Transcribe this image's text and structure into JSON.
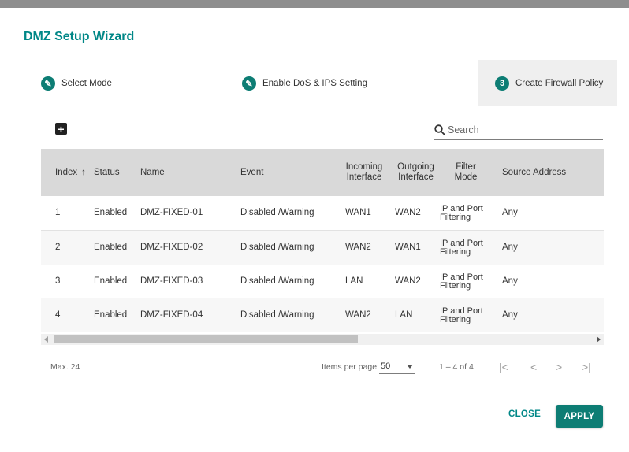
{
  "dialog": {
    "title": "DMZ Setup Wizard"
  },
  "stepper": {
    "steps": [
      {
        "label": "Select Mode",
        "marker": "✎",
        "icon": "pencil-icon"
      },
      {
        "label": "Enable DoS & IPS Setting",
        "marker": "✎",
        "icon": "pencil-icon"
      },
      {
        "label": "Create Firewall Policy",
        "marker": "3"
      }
    ],
    "active_color": "#0d7d74"
  },
  "toolbar": {
    "add_icon": "plus-square-icon",
    "add_glyph": "+",
    "search_placeholder": "Search",
    "search_value": ""
  },
  "table": {
    "sort_arrow": "↑",
    "columns": [
      "Index",
      "Status",
      "Name",
      "Event",
      "Incoming Interface",
      "Outgoing Interface",
      "Filter Mode",
      "Source Address"
    ],
    "rows": [
      {
        "index": "1",
        "status": "Enabled",
        "name": "DMZ-FIXED-01",
        "event": "Disabled /Warning",
        "incoming": "WAN1",
        "outgoing": "WAN2",
        "filter_mode": "IP and Port Filtering",
        "source": "Any"
      },
      {
        "index": "2",
        "status": "Enabled",
        "name": "DMZ-FIXED-02",
        "event": "Disabled /Warning",
        "incoming": "WAN2",
        "outgoing": "WAN1",
        "filter_mode": "IP and Port Filtering",
        "source": "Any"
      },
      {
        "index": "3",
        "status": "Enabled",
        "name": "DMZ-FIXED-03",
        "event": "Disabled /Warning",
        "incoming": "LAN",
        "outgoing": "WAN2",
        "filter_mode": "IP and Port Filtering",
        "source": "Any"
      },
      {
        "index": "4",
        "status": "Enabled",
        "name": "DMZ-FIXED-04",
        "event": "Disabled /Warning",
        "incoming": "WAN2",
        "outgoing": "LAN",
        "filter_mode": "IP and Port Filtering",
        "source": "Any"
      }
    ]
  },
  "footer": {
    "max_label": "Max. 24",
    "items_per_page_label": "Items per page:",
    "items_per_page_value": "50",
    "range_label": "1 – 4 of 4",
    "first_glyph": "|<",
    "prev_glyph": "<",
    "next_glyph": ">",
    "last_glyph": ">|"
  },
  "actions": {
    "close_label": "CLOSE",
    "apply_label": "APPLY"
  },
  "colors": {
    "accent": "#008787",
    "header_bg": "#d9d9d9",
    "step_active_bg": "#efefef"
  }
}
